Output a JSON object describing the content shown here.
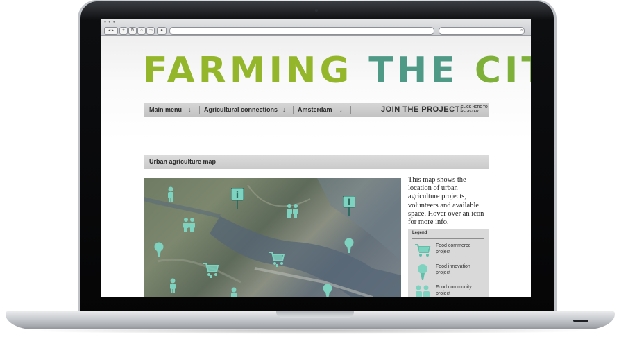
{
  "site": {
    "title_words": [
      "FARMING",
      "THE",
      "CITY"
    ],
    "menu": [
      {
        "label": "Main menu",
        "arrow": "↓"
      },
      {
        "label": "Agricultural connections",
        "arrow": "↓"
      },
      {
        "label": "Amsterdam",
        "arrow": "↓"
      }
    ],
    "join_label": "JOIN THE PROJECT!",
    "click_here": "CLICK HERE TO REGISTER",
    "section_title": "Urban agriculture map",
    "description": "This map shows the location of urban agriculture projects, volunteers and available space. Hover over an icon for more info.",
    "legend": {
      "title": "Legend",
      "items": [
        {
          "label": "Food commerce project",
          "icon": "shopping-cart-icon"
        },
        {
          "label": "Food innovation project",
          "icon": "lightbulb-icon"
        },
        {
          "label": "Food community project",
          "icon": "people-icon"
        }
      ]
    }
  },
  "colors": {
    "title_green": "#94b62a",
    "title_teal": "#4f9a86",
    "marker": "#7dd3c0"
  }
}
